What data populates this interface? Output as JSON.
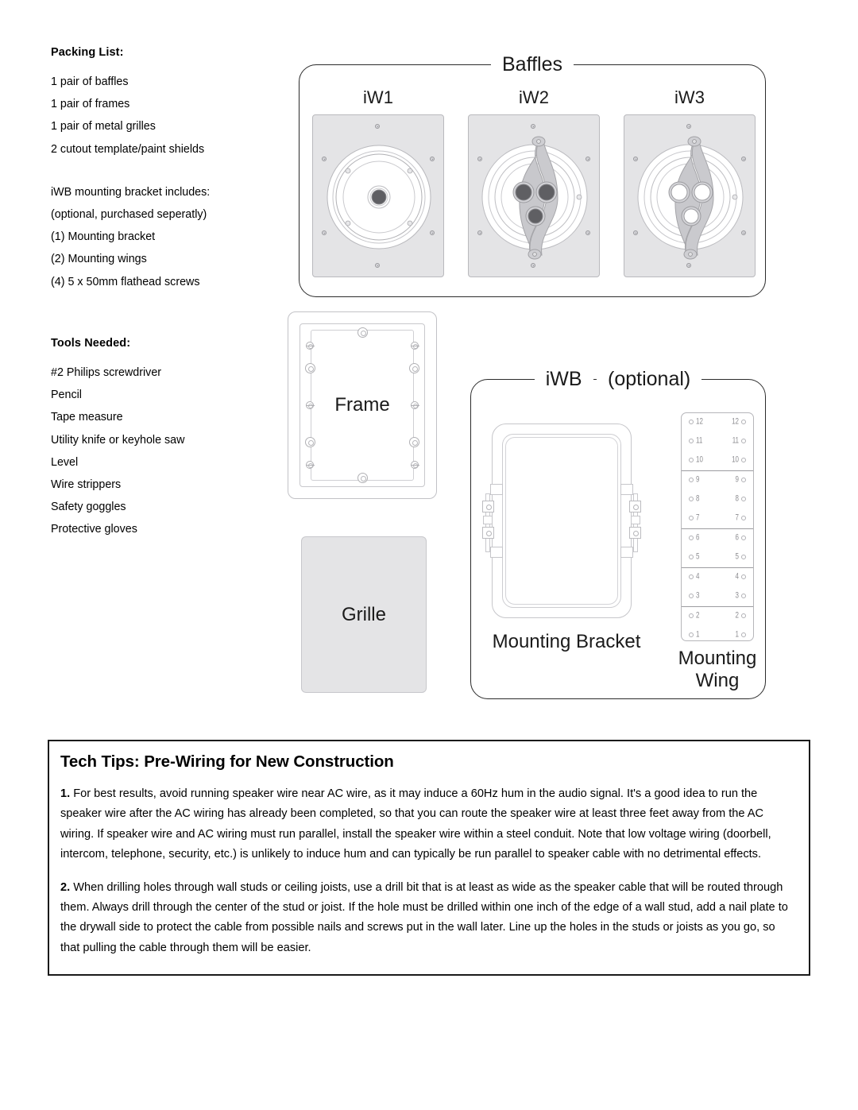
{
  "packing": {
    "heading": "Packing List:",
    "items": [
      "1 pair of baffles",
      "1 pair of frames",
      "1 pair of metal grilles",
      "2 cutout template/paint shields"
    ],
    "bracket_heading": "iWB mounting bracket includes:",
    "bracket_note": "(optional, purchased seperatly)",
    "bracket_items": [
      "(1) Mounting bracket",
      "(2) Mounting wings",
      "(4) 5 x 50mm flathead screws"
    ]
  },
  "tools": {
    "heading": "Tools Needed:",
    "items": [
      "#2 Philips screwdriver",
      "Pencil",
      "Tape measure",
      "Utility knife or keyhole saw",
      "Level",
      "Wire strippers",
      "Safety goggles",
      "Protective gloves"
    ]
  },
  "baffles": {
    "legend": "Baffles",
    "models": [
      {
        "label": "iW1",
        "style": "single-driver"
      },
      {
        "label": "iW2",
        "style": "triple-dark"
      },
      {
        "label": "iW3",
        "style": "triple-light"
      }
    ]
  },
  "frame": {
    "label": "Frame"
  },
  "grille": {
    "label": "Grille"
  },
  "iwb": {
    "legend": "iWB",
    "legend_sub": "(optional)",
    "bracket_label": "Mounting Bracket",
    "wing_label_line1": "Mounting",
    "wing_label_line2": "Wing",
    "wing_marks": [
      "12",
      "11",
      "10",
      "9",
      "8",
      "7",
      "6",
      "5",
      "4",
      "3",
      "2",
      "1"
    ]
  },
  "tech_tips": {
    "title": "Tech Tips: Pre-Wiring for New Construction",
    "paragraph_1_num": "1.",
    "paragraph_1": "For best results, avoid running speaker wire near AC wire, as it may induce a 60Hz hum in the audio signal.  It's a good idea to run the speaker wire after the AC wiring has already been completed, so that you can route the speaker wire at least three feet away from the AC wiring.  If speaker wire and AC wiring must run parallel, install the speaker wire within a steel conduit.  Note that low voltage wiring (doorbell, intercom, telephone, security, etc.) is unlikely to induce hum and can typically be run parallel to speaker cable with no detrimental effects.",
    "paragraph_2_num": "2.",
    "paragraph_2": "When drilling holes through wall studs or ceiling joists, use a drill bit that is at least as wide as the speaker cable that will be routed through them.  Always drill through the center of the stud or joist.  If the hole must be drilled within one inch of the edge of a wall stud, add a nail plate to the drywall side to protect the cable from possible nails and screws put in the wall later.  Line up the holes in the studs or joists as you go, so that pulling the cable through them will be easier."
  },
  "colors": {
    "ink": "#1a1a1a",
    "plate_fill": "#e4e4e6",
    "line": "#c2c2c6",
    "driver_dark": "#5f5f63"
  }
}
